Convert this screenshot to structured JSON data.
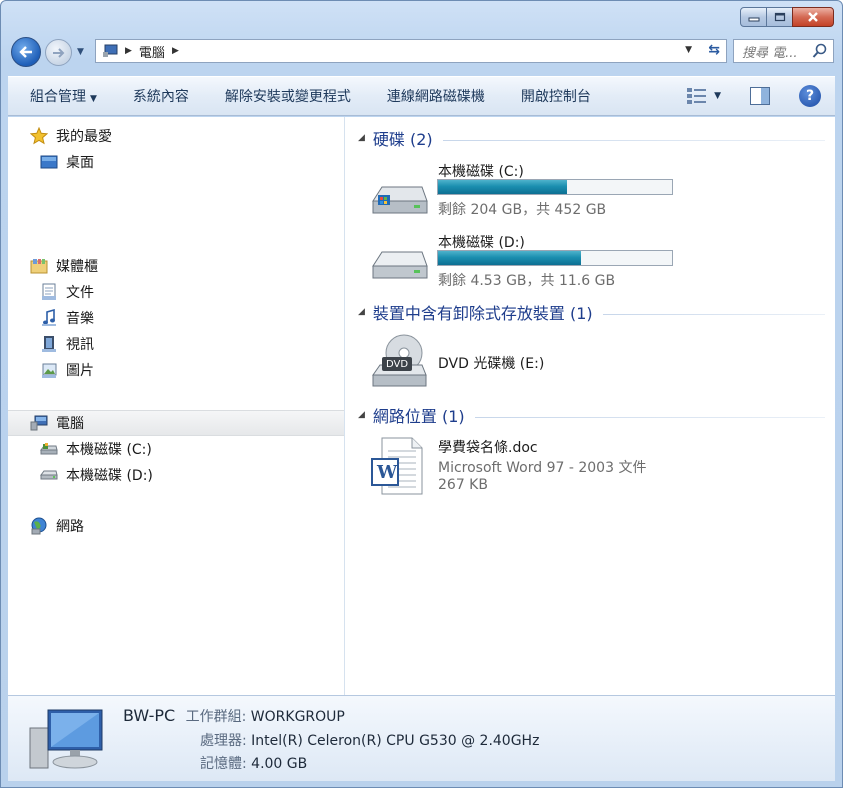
{
  "address": {
    "crumb": "電腦",
    "search_placeholder": "搜尋 電..."
  },
  "commands": {
    "organize": "組合管理",
    "properties": "系統內容",
    "uninstall": "解除安裝或變更程式",
    "map_drive": "連線網路磁碟機",
    "control_panel": "開啟控制台"
  },
  "navpane": {
    "favorites": "我的最愛",
    "desktop": "桌面",
    "libraries": "媒體櫃",
    "documents": "文件",
    "music": "音樂",
    "videos": "視訊",
    "pictures": "圖片",
    "computer": "電腦",
    "drive_c": "本機磁碟 (C:)",
    "drive_d": "本機磁碟 (D:)",
    "network": "網路"
  },
  "groups": {
    "hard_disks": "硬碟 (2)",
    "removable": "裝置中含有卸除式存放裝置 (1)",
    "network_locations": "網路位置 (1)"
  },
  "drives": [
    {
      "name": "本機磁碟 (C:)",
      "free_text": "剩餘 204 GB，共 452 GB",
      "used_fraction": 0.55
    },
    {
      "name": "本機磁碟 (D:)",
      "free_text": "剩餘 4.53 GB，共 11.6 GB",
      "used_fraction": 0.61
    }
  ],
  "dvd": {
    "name": "DVD 光碟機 (E:)",
    "badge": "DVD"
  },
  "network_file": {
    "name": "學費袋名條.doc",
    "type": "Microsoft Word 97 - 2003 文件",
    "size": "267 KB",
    "icon_letter": "W"
  },
  "status": {
    "pc_name": "BW-PC",
    "workgroup_label": "工作群組:",
    "workgroup": "WORKGROUP",
    "cpu_label": "處理器:",
    "cpu": "Intel(R) Celeron(R) CPU G530 @ 2.40GHz",
    "mem_label": "記憶體:",
    "mem": "4.00 GB"
  },
  "colors": {
    "group_title": "#1e3d8c",
    "usage_bar": "#1b8fb0",
    "command_text": "#1e395b"
  }
}
